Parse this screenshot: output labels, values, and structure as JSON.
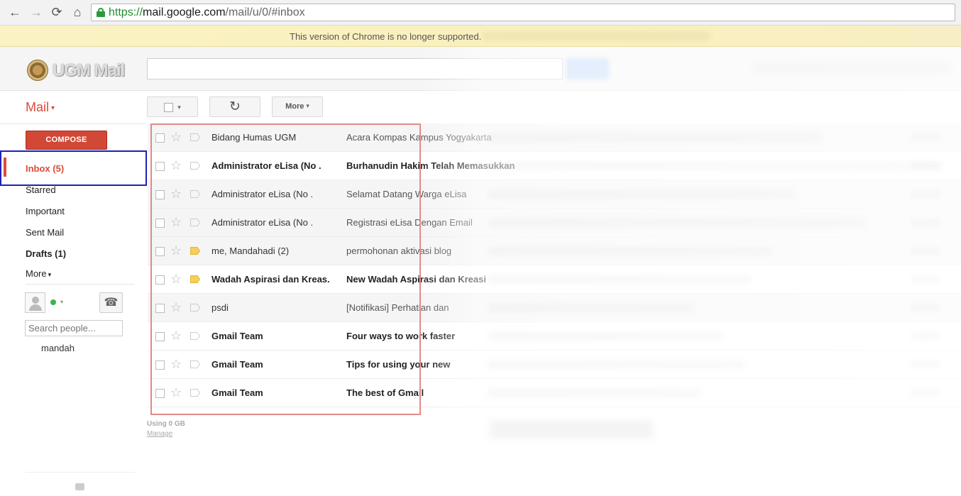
{
  "browser": {
    "back_icon": "←",
    "forward_icon": "→",
    "reload_icon": "⟳",
    "home_icon": "⌂",
    "url_scheme": "https://",
    "url_host": "mail.google.com",
    "url_path": "/mail/u/0/#inbox",
    "infobar_text": "This version of Chrome is no longer supported."
  },
  "header": {
    "logo_text": "UGM Mail",
    "search_placeholder": ""
  },
  "sidebar": {
    "mail_menu_label": "Mail",
    "compose_label": "COMPOSE",
    "items": [
      {
        "label": "Inbox (5)",
        "selected": true
      },
      {
        "label": "Starred"
      },
      {
        "label": "Important"
      },
      {
        "label": "Sent Mail"
      },
      {
        "label": "Drafts (1)"
      },
      {
        "label": "More"
      }
    ],
    "people_search_placeholder": "Search people...",
    "contact": "mandah",
    "caret": "▾"
  },
  "toolbar": {
    "more_label": "More",
    "refresh_icon": "↻",
    "caret": "▾"
  },
  "messages": [
    {
      "sender": "Bidang Humas UGM",
      "subject": "Acara Kompas Kampus Yogyakarta",
      "unread": false,
      "labeled": false
    },
    {
      "sender": "Administrator eLisa (No .",
      "subject": "Burhanudin Hakim Telah Memasukkan",
      "unread": true,
      "labeled": false
    },
    {
      "sender": "Administrator eLisa (No .",
      "subject": "Selamat Datang Warga eLisa",
      "unread": false,
      "labeled": false
    },
    {
      "sender": "Administrator eLisa (No .",
      "subject": "Registrasi eLisa Dengan Email",
      "unread": false,
      "labeled": false
    },
    {
      "sender": "me, Mandahadi (2)",
      "subject": "permohonan aktivasi blog",
      "unread": false,
      "labeled": true
    },
    {
      "sender": "Wadah Aspirasi dan Kreas.",
      "subject": "New Wadah Aspirasi dan Kreasi",
      "unread": true,
      "labeled": true
    },
    {
      "sender": "psdi",
      "subject": "[Notifikasi] Perhatian dan",
      "unread": false,
      "labeled": false
    },
    {
      "sender": "Gmail Team",
      "subject": "Four ways to work faster",
      "unread": true,
      "labeled": false
    },
    {
      "sender": "Gmail Team",
      "subject": "Tips for using your new",
      "unread": true,
      "labeled": false
    },
    {
      "sender": "Gmail Team",
      "subject": "The best of Gmail",
      "unread": true,
      "labeled": false
    }
  ],
  "footer": {
    "usage": "Using 0 GB",
    "manage": "Manage"
  },
  "colors": {
    "accent": "#dd4b39",
    "compose": "#d14836",
    "highlight_box": "#1f20b8",
    "list_box": "#e08a8a"
  }
}
